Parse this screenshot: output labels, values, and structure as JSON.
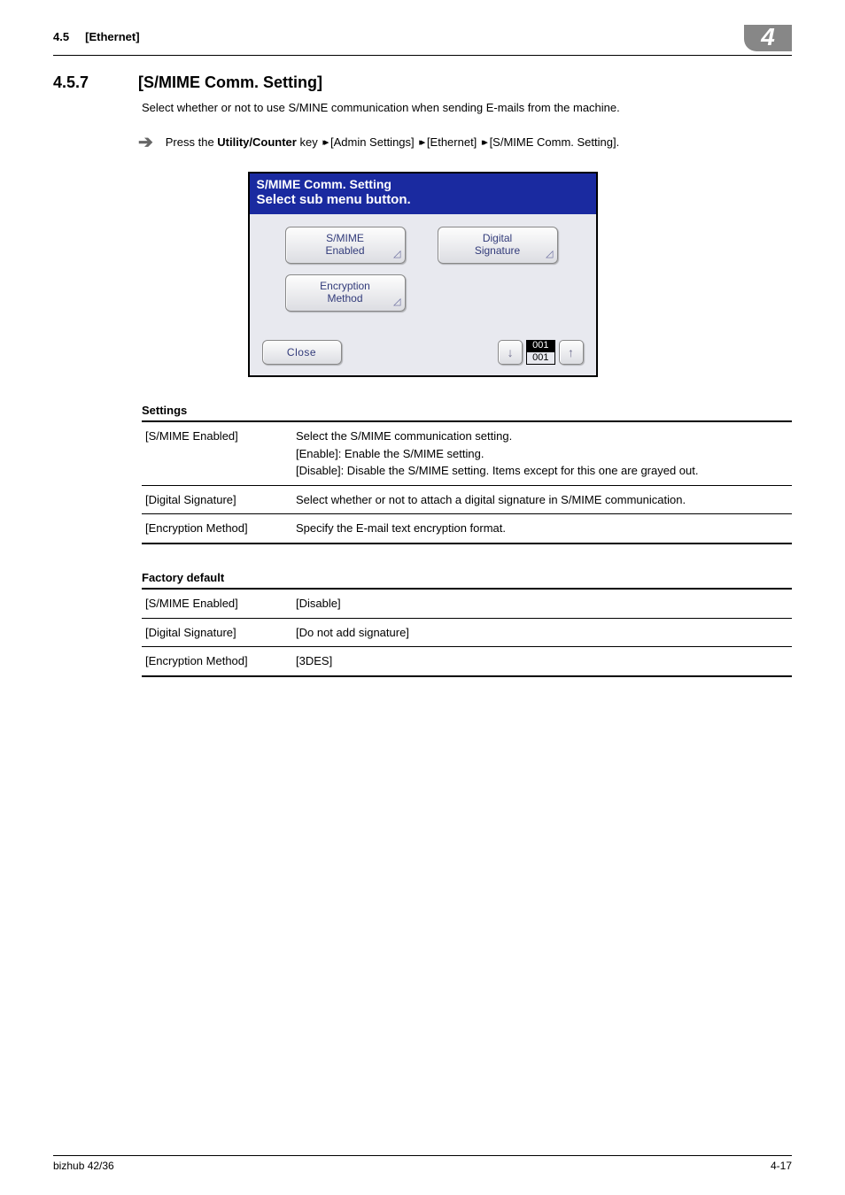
{
  "header": {
    "section_no": "4.5",
    "section_name": "[Ethernet]",
    "chapter_badge": "4"
  },
  "section": {
    "number": "4.5.7",
    "title": "[S/MIME Comm. Setting]",
    "intro": "Select whether or not to use S/MINE communication when sending E-mails from the machine.",
    "nav_prefix": "Press the ",
    "nav_key": "Utility/Counter",
    "nav_mid1": " key ",
    "nav_path1": " [Admin Settings] ",
    "nav_path2": " [Ethernet] ",
    "nav_path3": " [S/MIME Comm. Setting]."
  },
  "panel": {
    "title_line1": "S/MIME Comm. Setting",
    "title_line2": "Select sub menu button.",
    "buttons": {
      "smime_enabled": "S/MIME\nEnabled",
      "digital_signature": "Digital\nSignature",
      "encryption_method": "Encryption\nMethod"
    },
    "close": "Close",
    "page_current": "001",
    "page_total": "001"
  },
  "tables": {
    "settings_title": "Settings",
    "settings_rows": [
      {
        "key": "[S/MIME Enabled]",
        "val": "Select the S/MIME communication setting.\n[Enable]: Enable the S/MIME setting.\n[Disable]: Disable the S/MIME setting. Items except for this one are grayed out."
      },
      {
        "key": "[Digital Signature]",
        "val": "Select whether or not to attach a digital signature in S/MIME communication."
      },
      {
        "key": "[Encryption Method]",
        "val": "Specify the E-mail text encryption format."
      }
    ],
    "defaults_title": "Factory default",
    "defaults_rows": [
      {
        "key": "[S/MIME Enabled]",
        "val": "[Disable]"
      },
      {
        "key": "[Digital Signature]",
        "val": "[Do not add signature]"
      },
      {
        "key": "[Encryption Method]",
        "val": "[3DES]"
      }
    ]
  },
  "footer": {
    "left": "bizhub 42/36",
    "right": "4-17"
  }
}
